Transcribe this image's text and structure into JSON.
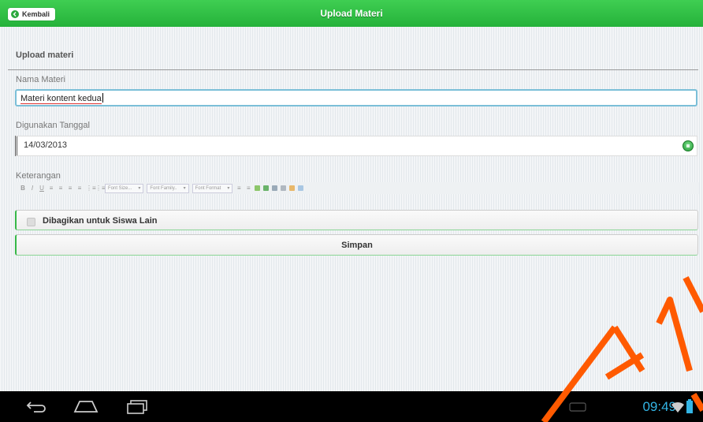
{
  "header": {
    "back_label": "Kembali",
    "title": "Upload Materi"
  },
  "form": {
    "section_title": "Upload materi",
    "nama_label": "Nama Materi",
    "nama_value": "Materi kontent kedua",
    "tanggal_label": "Digunakan Tanggal",
    "tanggal_value": "14/03/2013",
    "keterangan_label": "Keterangan",
    "toolbar": {
      "buttons": [
        "B",
        "I",
        "U",
        "≡",
        "≡",
        "≡",
        "≡",
        "⋮≡",
        "⋮≡"
      ],
      "font_size": "Font Size...",
      "font_family": "Font Family..",
      "font_format": "Font Format"
    },
    "share_label": "Dibagikan untuk Siswa Lain",
    "save_label": "Simpan"
  },
  "status_bar": {
    "time": "09:49"
  },
  "colors": {
    "header_green": "#2fbf44",
    "clock_blue": "#33b5e5",
    "accent_green": "#36b848"
  }
}
